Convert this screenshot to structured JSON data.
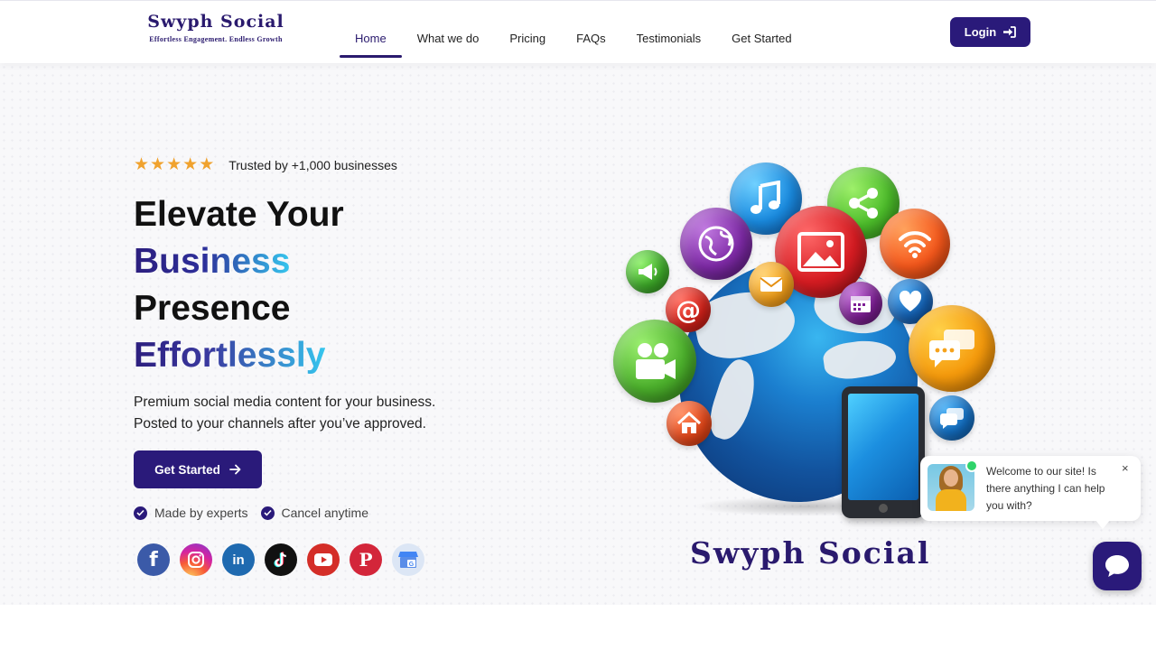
{
  "header": {
    "logo_name": "Swyph Social",
    "logo_tagline": "Effortless Engagement. Endless Growth",
    "nav": [
      {
        "label": "Home",
        "active": true
      },
      {
        "label": "What we do"
      },
      {
        "label": "Pricing"
      },
      {
        "label": "FAQs"
      },
      {
        "label": "Testimonials"
      },
      {
        "label": "Get Started"
      }
    ],
    "login_label": "Login"
  },
  "hero": {
    "rating_stars": 5,
    "trusted_text": "Trusted by +1,000 businesses",
    "headline": [
      "Elevate Your",
      "Business",
      "Presence",
      "Effortlessly"
    ],
    "subtext": [
      "Premium social media content for your business.",
      "Posted to your channels after you’ve approved."
    ],
    "cta_label": "Get Started",
    "checks": [
      "Made by experts",
      "Cancel anytime"
    ],
    "socials": [
      "facebook-icon",
      "instagram-icon",
      "linkedin-icon",
      "tiktok-icon",
      "youtube-icon",
      "pinterest-icon",
      "google-business-icon"
    ]
  },
  "illustration": {
    "brand_text": "Swyph Social"
  },
  "chat": {
    "message": "Welcome to our site! Is there anything I can help you with?",
    "close_label": "×"
  },
  "colors": {
    "brand": "#2a1a7a",
    "accent_cyan": "#36c6ee",
    "star": "#f0a22e"
  }
}
